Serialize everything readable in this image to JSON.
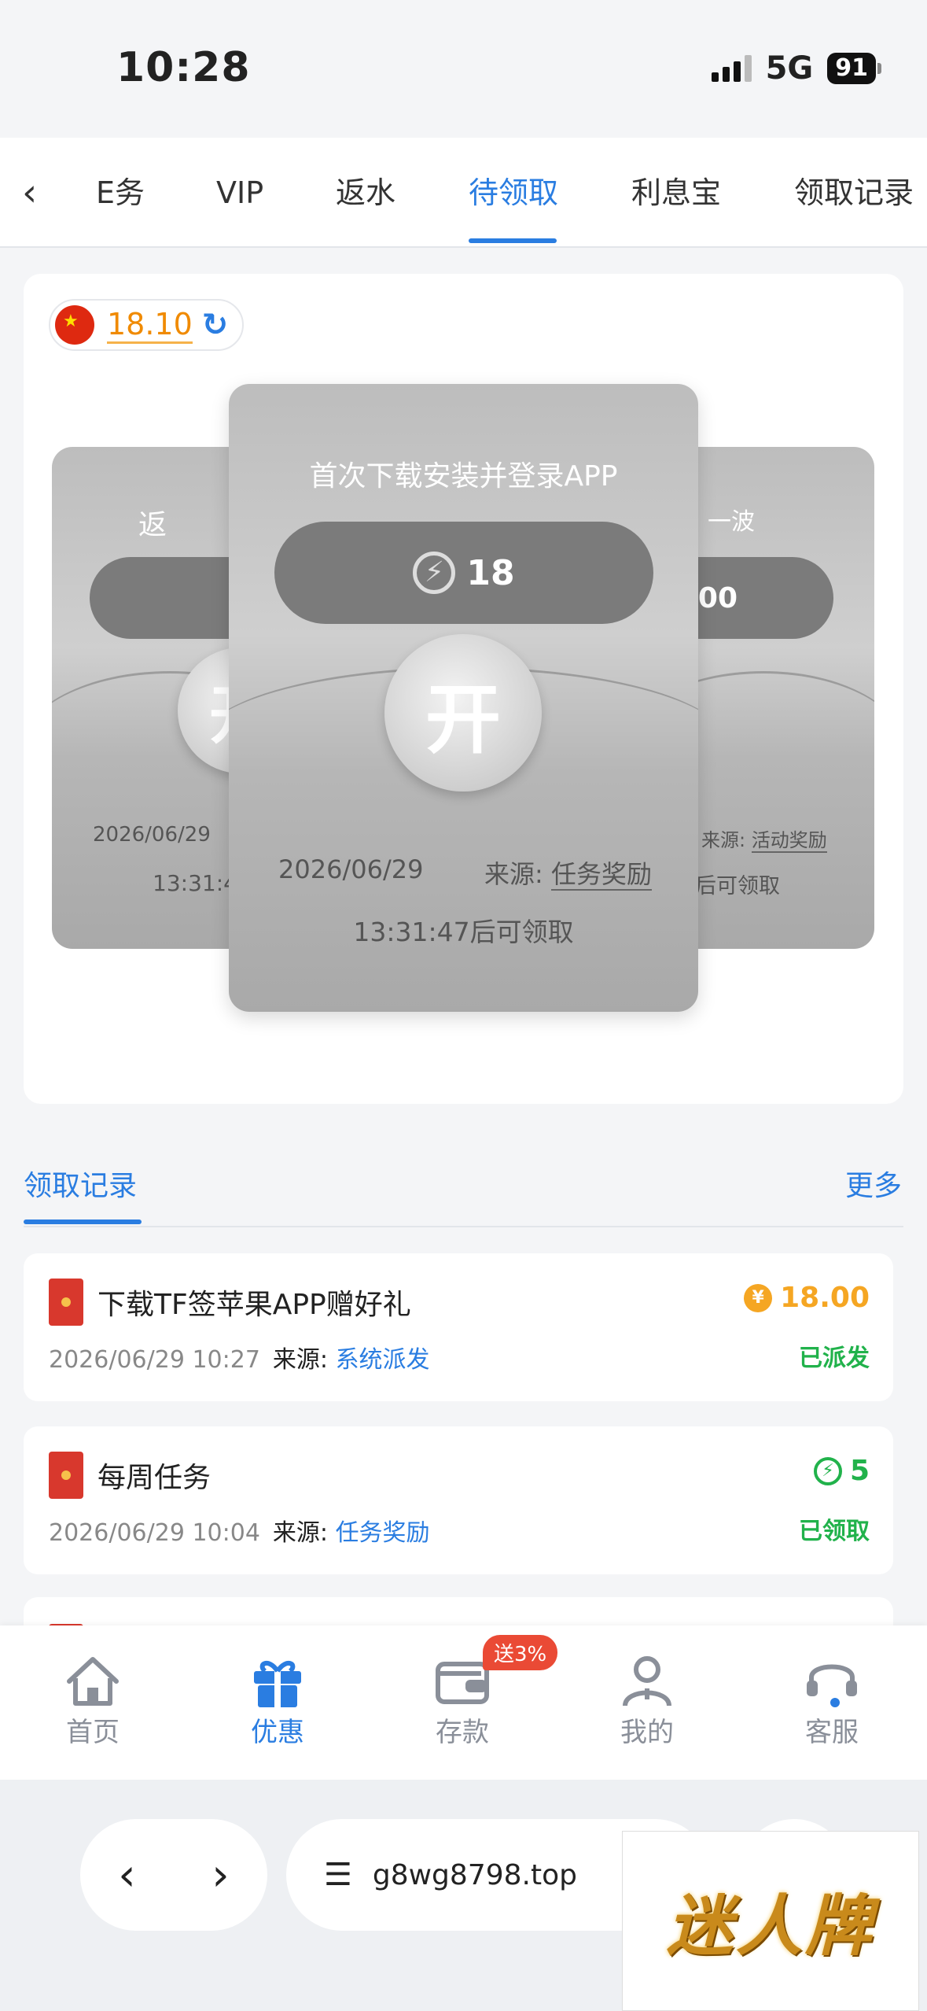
{
  "status_bar": {
    "time": "10:28",
    "network": "5G",
    "battery": "91"
  },
  "tabs": {
    "items": [
      {
        "label": "任务",
        "display": "E务"
      },
      {
        "label": "VIP"
      },
      {
        "label": "返水"
      },
      {
        "label": "待领取",
        "active": true
      },
      {
        "label": "利息宝"
      },
      {
        "label": "领取记录"
      }
    ]
  },
  "balance": {
    "value": "18.10"
  },
  "cards": {
    "left": {
      "title_partial": "返",
      "amount_partial": "",
      "button": "开",
      "date": "2026/06/29",
      "countdown_partial": "13:31:4"
    },
    "center": {
      "title": "首次下载安装并登录APP",
      "amount": "18",
      "button": "开",
      "date": "2026/06/29",
      "source_label": "来源:",
      "source": "任务奖励",
      "countdown": "13:31:47后可领取"
    },
    "right": {
      "title_partial": "一波",
      "amount_partial": "00",
      "button": "开",
      "source_label": "来源:",
      "source": "活动奖励",
      "countdown_partial": "后可领取"
    }
  },
  "records": {
    "title": "领取记录",
    "more": "更多",
    "items": [
      {
        "title": "下载TF签苹果APP赠好礼",
        "datetime": "2026/06/29 10:27",
        "source_label": "来源:",
        "source": "系统派发",
        "amount": "18.00",
        "status": "已派发",
        "amount_color": "#f5a623"
      },
      {
        "title": "每周任务",
        "datetime": "2026/06/29 10:04",
        "source_label": "来源:",
        "source": "任务奖励",
        "amount": "5",
        "status": "已领取",
        "amount_color": "#21b24b"
      }
    ]
  },
  "bottom_nav": {
    "items": [
      {
        "label": "首页",
        "icon": "home-icon"
      },
      {
        "label": "优惠",
        "icon": "gift-icon",
        "active": true
      },
      {
        "label": "存款",
        "icon": "wallet-icon"
      },
      {
        "label": "我的",
        "icon": "user-icon"
      },
      {
        "label": "客服",
        "icon": "headset-icon"
      }
    ],
    "deposit_badge": "送3%"
  },
  "browser": {
    "url": "g8wg8798.top"
  },
  "watermark": {
    "text": "迷人牌"
  },
  "colors": {
    "accent": "#2a7de1",
    "gold": "#f5a623",
    "green": "#21b24b",
    "red": "#d8382d"
  }
}
